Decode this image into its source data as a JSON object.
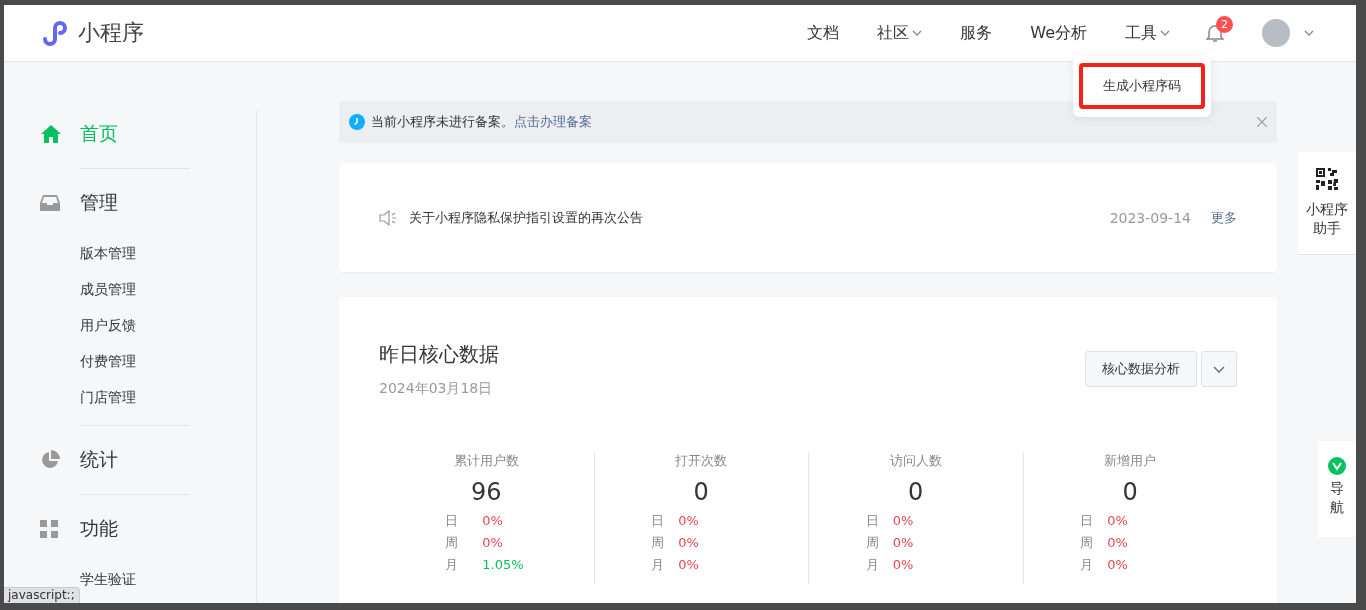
{
  "header": {
    "logo_text": "小程序",
    "nav": [
      {
        "label": "文档"
      },
      {
        "label": "社区",
        "has_menu": true
      },
      {
        "label": "服务"
      },
      {
        "label": "We分析"
      },
      {
        "label": "工具",
        "has_menu": true,
        "expanded": true,
        "menu": [
          {
            "label": "生成小程序码",
            "highlighted": true
          }
        ]
      }
    ],
    "notifications": "2"
  },
  "sidebar": {
    "sections": [
      {
        "kind": "home",
        "label": "首页",
        "selected": true
      },
      {
        "kind": "manage",
        "label": "管理",
        "selected": false,
        "children": [
          {
            "label": "版本管理"
          },
          {
            "label": "成员管理"
          },
          {
            "label": "用户反馈"
          },
          {
            "label": "付费管理"
          },
          {
            "label": "门店管理"
          }
        ]
      },
      {
        "kind": "stats",
        "label": "统计",
        "selected": false
      },
      {
        "kind": "features",
        "label": "功能",
        "selected": false,
        "children": [
          {
            "label": "学生验证"
          }
        ]
      }
    ]
  },
  "notice": {
    "text": "当前小程序未进行备案。",
    "link": "点击办理备案"
  },
  "announcement": {
    "text": "关于小程序隐私保护指引设置的再次公告",
    "date": "2023-09-14",
    "more": "更多"
  },
  "core_data": {
    "title": "昨日核心数据",
    "date": "2024年03月18日",
    "button": "核心数据分析",
    "stats": [
      {
        "label": "累计用户数",
        "value": "96",
        "rows": [
          {
            "period": "日",
            "change": "0%",
            "color": "#e5484d"
          },
          {
            "period": "周",
            "change": "0%",
            "color": "#e5484d"
          },
          {
            "period": "月",
            "change": "1.05%",
            "color": "#07c160"
          }
        ]
      },
      {
        "label": "打开次数",
        "value": "0",
        "rows": [
          {
            "period": "日",
            "change": "0%",
            "color": "#e5484d"
          },
          {
            "period": "周",
            "change": "0%",
            "color": "#e5484d"
          },
          {
            "period": "月",
            "change": "0%",
            "color": "#e5484d"
          }
        ]
      },
      {
        "label": "访问人数",
        "value": "0",
        "rows": [
          {
            "period": "日",
            "change": "0%",
            "color": "#e5484d"
          },
          {
            "period": "周",
            "change": "0%",
            "color": "#e5484d"
          },
          {
            "period": "月",
            "change": "0%",
            "color": "#e5484d"
          }
        ]
      },
      {
        "label": "新增用户",
        "value": "0",
        "rows": [
          {
            "period": "日",
            "change": "0%",
            "color": "#e5484d"
          },
          {
            "period": "周",
            "change": "0%",
            "color": "#e5484d"
          },
          {
            "period": "月",
            "change": "0%",
            "color": "#e5484d"
          }
        ]
      }
    ]
  },
  "float_tools": [
    {
      "kind": "qr",
      "label": "小程序助手"
    },
    {
      "kind": "guide",
      "label": "导航"
    }
  ],
  "status_bar": {
    "text": "javascript:;"
  }
}
